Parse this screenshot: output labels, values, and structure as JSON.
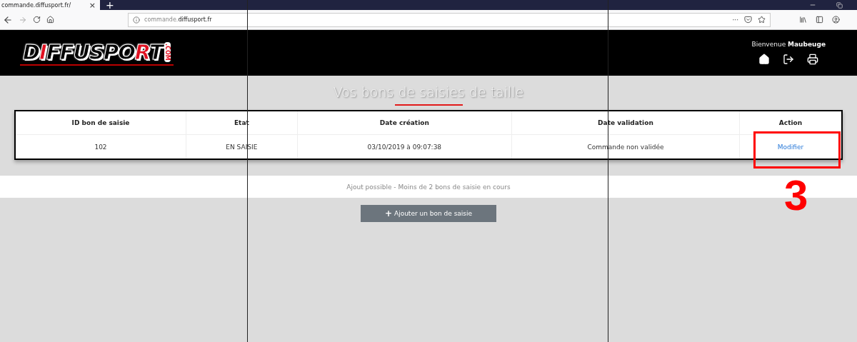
{
  "browser": {
    "tab_title": "commande.diffusport.fr/",
    "tab_close": "×",
    "new_tab": "+",
    "url_prefix": "commande.",
    "url_domain": "diffusport.fr",
    "page_actions": "···"
  },
  "header": {
    "logo": [
      {
        "text": "D",
        "accent": false
      },
      {
        "text": "I",
        "accent": true
      },
      {
        "text": "FFUSPO",
        "accent": false
      },
      {
        "text": "R",
        "accent": true
      },
      {
        "text": "T",
        "accent": false
      }
    ],
    "logo_suffix": ".COM",
    "welcome": "Bienvenue",
    "user": "Maubeuge"
  },
  "title": "Vos bons de saisies de taille",
  "table": {
    "columns": [
      "ID bon de saisie",
      "Etat",
      "Date création",
      "Date validation",
      "Action"
    ],
    "rows": [
      {
        "id": "102",
        "state": "EN SAISIE",
        "created": "03/10/2019 à 09:07:38",
        "validation": "Commande non validée",
        "action": "Modifier"
      }
    ]
  },
  "notice": "Ajout possible - Moins de 2 bons de saisie en cours",
  "add_button": {
    "icon": "+",
    "label": "Ajouter un bon de saisie"
  },
  "annotation": {
    "label": "3"
  }
}
